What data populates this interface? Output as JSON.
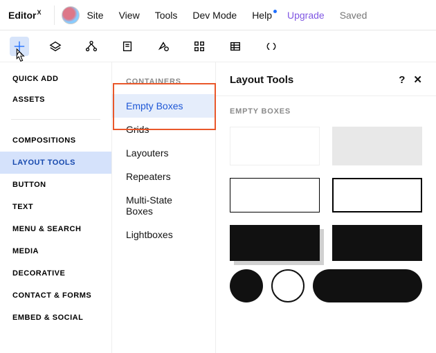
{
  "brand": "Editor",
  "brand_sup": "X",
  "topmenu": {
    "site": "Site",
    "view": "View",
    "tools": "Tools",
    "dev": "Dev Mode",
    "help": "Help",
    "upgrade": "Upgrade",
    "saved": "Saved"
  },
  "quick": {
    "quick_add": "QUICK ADD",
    "assets": "ASSETS"
  },
  "categories": {
    "compositions": "COMPOSITIONS",
    "layout_tools": "LAYOUT TOOLS",
    "button": "BUTTON",
    "text": "TEXT",
    "menu_search": "MENU & SEARCH",
    "media": "MEDIA",
    "decorative": "DECORATIVE",
    "contact_forms": "CONTACT & FORMS",
    "embed_social": "EMBED & SOCIAL"
  },
  "containers": {
    "header": "CONTAINERS",
    "empty_boxes": "Empty Boxes",
    "grids": "Grids",
    "layouters": "Layouters",
    "repeaters": "Repeaters",
    "multi_state": "Multi-State Boxes",
    "lightboxes": "Lightboxes"
  },
  "pane": {
    "title": "Layout Tools",
    "help": "?",
    "close": "✕",
    "section": "EMPTY BOXES"
  }
}
